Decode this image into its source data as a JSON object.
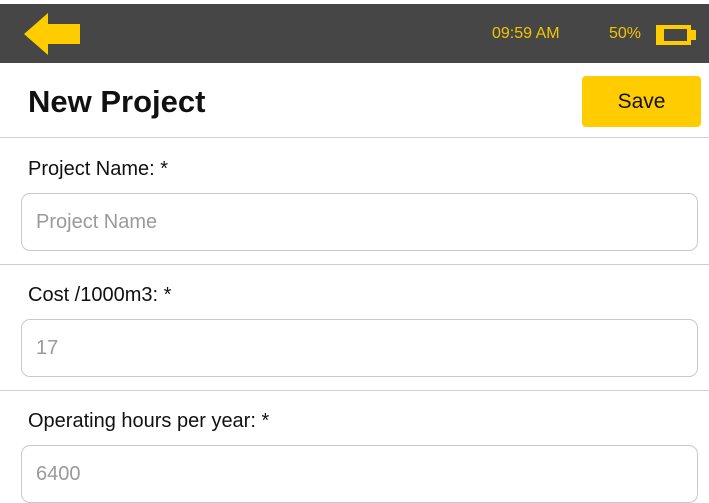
{
  "status_bar": {
    "time": "09:59 AM",
    "battery_percent": "50%",
    "battery_level": 0.5,
    "accent_color": "#f5c400",
    "background_color": "#464646",
    "back_icon": "arrow-left-icon",
    "battery_icon": "battery-icon"
  },
  "header": {
    "title": "New Project",
    "save_label": "Save",
    "save_color": "#ffcc00"
  },
  "form": {
    "project_name": {
      "label": "Project Name: *",
      "value": "",
      "placeholder": "Project Name"
    },
    "cost": {
      "label": "Cost /1000m3: *",
      "value": "",
      "placeholder": "17"
    },
    "operating_hours": {
      "label": "Operating hours per year: *",
      "value": "",
      "placeholder": "6400"
    }
  }
}
